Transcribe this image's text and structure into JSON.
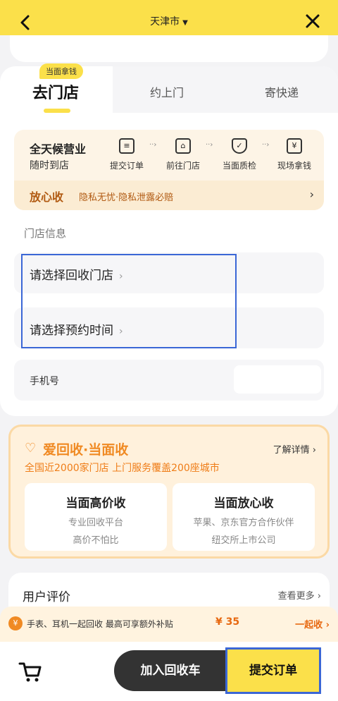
{
  "header": {
    "city": "天津市",
    "back_icon": "chevron-left-icon",
    "close_icon": "close-icon"
  },
  "tabs": {
    "badge": "当面拿钱",
    "items": [
      {
        "label": "去门店",
        "active": true
      },
      {
        "label": "约上门",
        "active": false
      },
      {
        "label": "寄快递",
        "active": false
      }
    ]
  },
  "process": {
    "title": "全天候营业",
    "subtitle": "随时到店",
    "steps": [
      {
        "label": "提交订单",
        "icon": "form-icon"
      },
      {
        "label": "前往门店",
        "icon": "store-icon"
      },
      {
        "label": "当面质检",
        "icon": "shield-check-icon"
      },
      {
        "label": "现场拿钱",
        "icon": "yen-icon"
      }
    ],
    "peace": {
      "title": "放心收",
      "text": "隐私无忧·隐私泄露必赔"
    }
  },
  "store_info": {
    "section_label": "门店信息",
    "select_store": "请选择回收门店",
    "select_time": "请选择预约时间",
    "phone_label": "手机号"
  },
  "banner": {
    "brand": "爱回收·当面收",
    "more": "了解详情",
    "subtitle": "全国近2000家门店 上门服务覆盖200座城市",
    "cards": [
      {
        "title": "当面高价收",
        "lines": [
          "专业回收平台",
          "高价不怕比"
        ]
      },
      {
        "title": "当面放心收",
        "lines": [
          "苹果、京东官方合作伙伴",
          "纽交所上市公司"
        ]
      }
    ]
  },
  "reviews": {
    "title": "用户评价",
    "more": "查看更多"
  },
  "promo": {
    "text": "手表、耳机一起回收 最高可享额外补贴",
    "amount": "¥ 35",
    "cta": "一起收"
  },
  "bottom": {
    "add_to_cart": "加入回收车",
    "submit": "提交订单",
    "cart_icon": "cart-icon"
  },
  "colors": {
    "accent_yellow": "#fbe04a",
    "orange": "#f08a23",
    "brown": "#b15a12",
    "highlight_blue": "#3b67d6"
  }
}
